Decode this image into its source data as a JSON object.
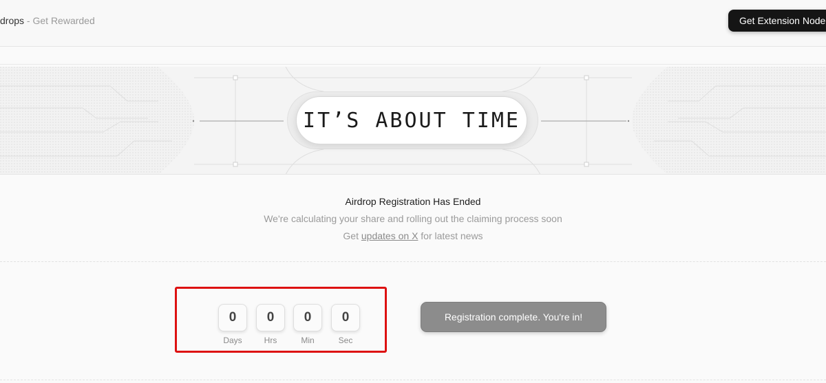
{
  "header": {
    "brand_name": "drops",
    "brand_sep": " - ",
    "brand_tagline": "Get Rewarded",
    "extension_button": "Get Extension Node"
  },
  "banner": {
    "headline": "IT’S ABOUT TIME"
  },
  "status": {
    "title": "Airdrop Registration Has Ended",
    "subtitle": "We're calculating your share and rolling out the claiming process soon",
    "news_prefix": "Get ",
    "news_link": "updates on X",
    "news_suffix": " for latest news"
  },
  "countdown": {
    "units": [
      {
        "value": "0",
        "label": "Days"
      },
      {
        "value": "0",
        "label": "Hrs"
      },
      {
        "value": "0",
        "label": "Min"
      },
      {
        "value": "0",
        "label": "Sec"
      }
    ]
  },
  "registration": {
    "button": "Registration complete. You're in!"
  },
  "colors": {
    "highlight": "#dd1111",
    "button_dark": "#151515",
    "button_disabled": "#8c8c8c"
  }
}
